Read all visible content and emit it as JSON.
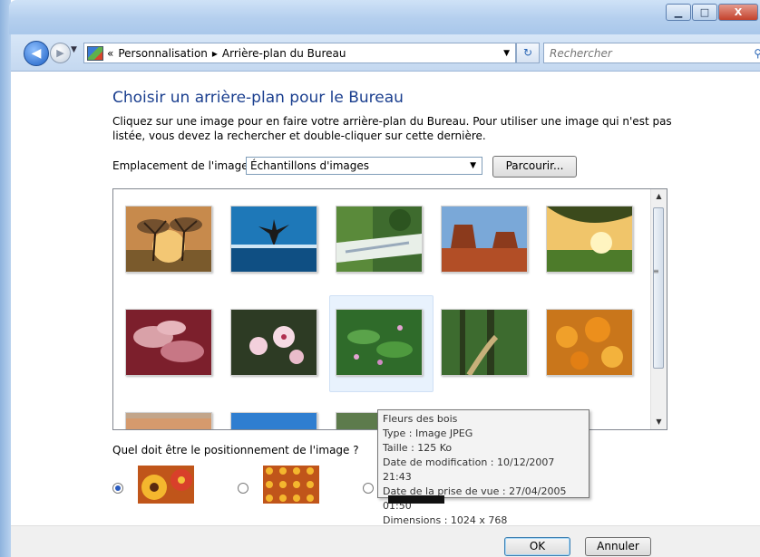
{
  "window": {
    "controls": [
      "minimize",
      "maximize",
      "close"
    ],
    "close_label": "X"
  },
  "nav": {
    "breadcrumb_prefix": "«",
    "breadcrumb": [
      "Personnalisation",
      "Arrière-plan du Bureau"
    ],
    "separator": "▸",
    "search_placeholder": "Rechercher"
  },
  "main": {
    "title": "Choisir un arrière-plan pour le Bureau",
    "description": "Cliquez sur une image pour en faire votre arrière-plan du Bureau. Pour utiliser une image qui n'est pas listée, vous devez la rechercher et double-cliquer sur cette dernière.",
    "location_label": "Emplacement de l'image",
    "location_value": "Échantillons d'images",
    "browse_label": "Parcourir..."
  },
  "tooltip": {
    "lines": [
      "Fleurs des bois",
      "Type : Image JPEG",
      "Taille : 125 Ko",
      "Date de modification : 10/12/2007 21:43",
      "Date de la prise de vue : 27/04/2005 01:50",
      "Dimensions : 1024 x 768"
    ]
  },
  "position": {
    "question": "Quel doit être le positionnement de l'image ?",
    "selected_option": 0
  },
  "footer": {
    "ok_label": "OK",
    "cancel_label": "Annuler"
  },
  "colors": {
    "heading": "#1b3f8f",
    "selection": "#e8f2fd"
  }
}
